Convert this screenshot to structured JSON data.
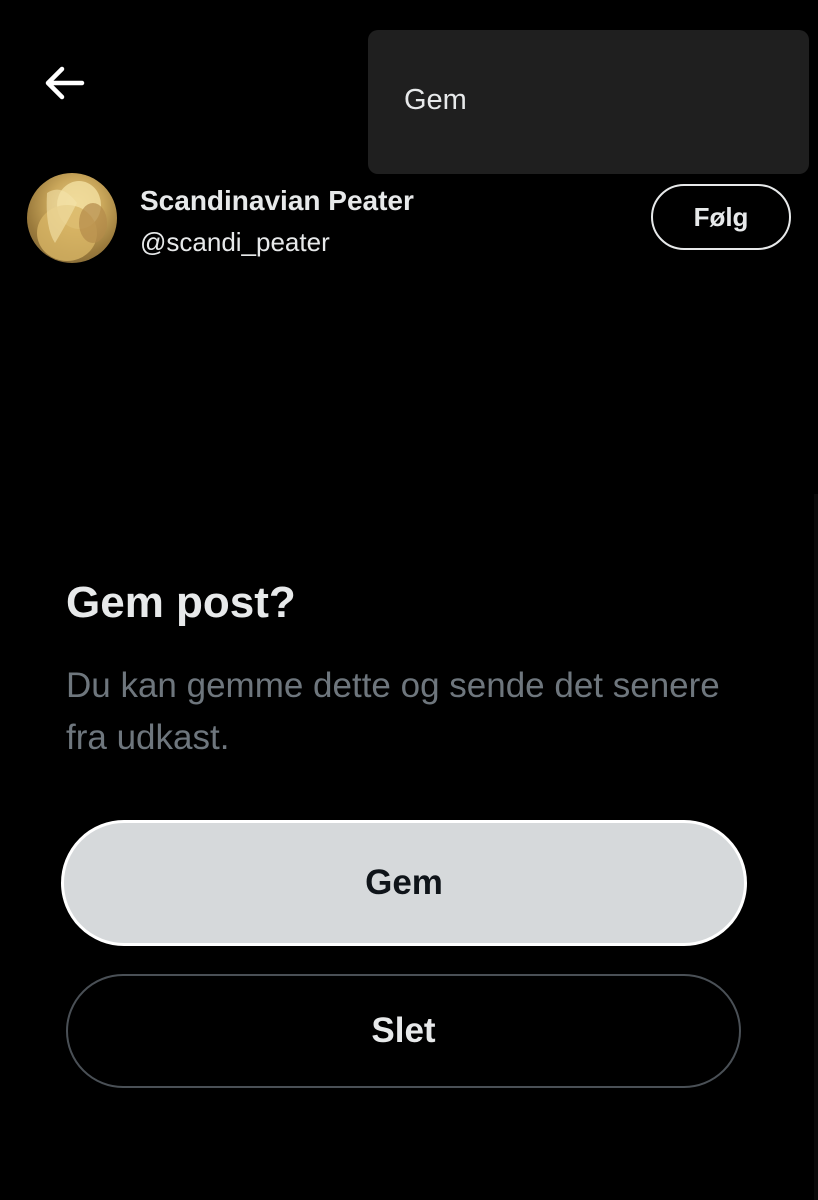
{
  "header": {
    "back_icon": "arrow-left-icon"
  },
  "menu": {
    "items": [
      {
        "label": "Gem"
      }
    ]
  },
  "profile": {
    "display_name": "Scandinavian Peater",
    "handle": "@scandi_peater",
    "follow_label": "Følg"
  },
  "dialog": {
    "title": "Gem post?",
    "body": "Du kan gemme dette og sende det senere fra udkast.",
    "save_label": "Gem",
    "delete_label": "Slet"
  },
  "colors": {
    "background": "#000000",
    "text_primary": "#e7e9ea",
    "text_secondary": "#6e767d",
    "menu_background": "#1f1f1f",
    "save_button_bg": "#d6d9db"
  }
}
